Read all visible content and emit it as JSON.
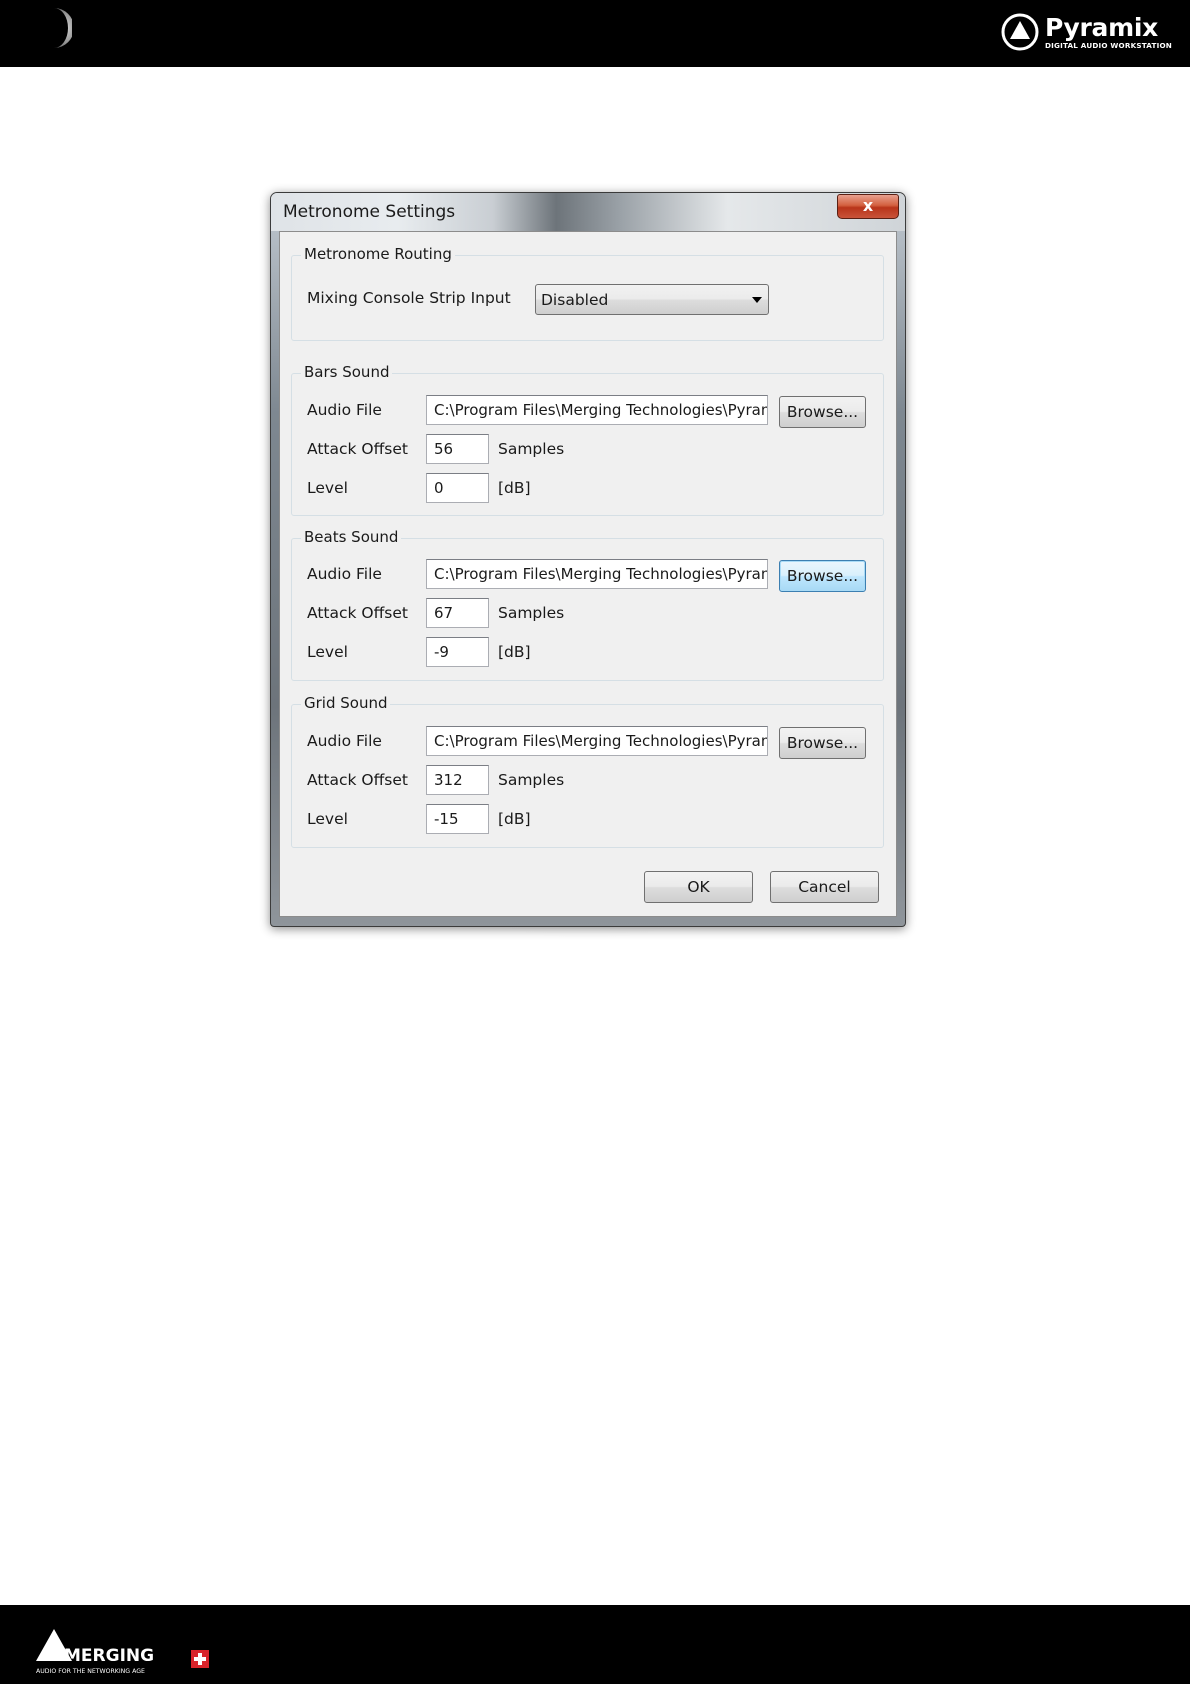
{
  "header": {
    "brand_name": "Pyramix",
    "brand_tagline": "DIGITAL AUDIO WORKSTATION"
  },
  "footer": {
    "brand_name": "MERGING",
    "brand_tagline": "AUDIO FOR THE NETWORKING AGE"
  },
  "dialog": {
    "title": "Metronome Settings",
    "close_label": "x",
    "routing": {
      "group_title": "Metronome Routing",
      "strip_input_label": "Mixing Console Strip Input",
      "strip_input_value": "Disabled"
    },
    "bars": {
      "group_title": "Bars Sound",
      "audio_file_label": "Audio File",
      "audio_file_value": "C:\\Program Files\\Merging Technologies\\Pyram",
      "browse_label": "Browse...",
      "attack_offset_label": "Attack Offset",
      "attack_offset_value": "56",
      "attack_offset_unit": "Samples",
      "level_label": "Level",
      "level_value": "0",
      "level_unit": "[dB]"
    },
    "beats": {
      "group_title": "Beats Sound",
      "audio_file_label": "Audio File",
      "audio_file_value": "C:\\Program Files\\Merging Technologies\\Pyram",
      "browse_label": "Browse...",
      "attack_offset_label": "Attack Offset",
      "attack_offset_value": "67",
      "attack_offset_unit": "Samples",
      "level_label": "Level",
      "level_value": "-9",
      "level_unit": "[dB]"
    },
    "grid": {
      "group_title": "Grid Sound",
      "audio_file_label": "Audio File",
      "audio_file_value": "C:\\Program Files\\Merging Technologies\\Pyram",
      "browse_label": "Browse...",
      "attack_offset_label": "Attack Offset",
      "attack_offset_value": "312",
      "attack_offset_unit": "Samples",
      "level_label": "Level",
      "level_value": "-15",
      "level_unit": "[dB]"
    },
    "ok_label": "OK",
    "cancel_label": "Cancel"
  },
  "colors": {
    "header_bg": "#000000",
    "close_button": "#c9543a",
    "focused_button_border": "#3c7fb1",
    "dialog_client_bg": "#f0f0f0"
  },
  "icons": {
    "header_left": "moon-icon",
    "header_right": "pyramix-logo",
    "footer_left": "merging-logo",
    "dropdown": "chevron-down-icon"
  }
}
